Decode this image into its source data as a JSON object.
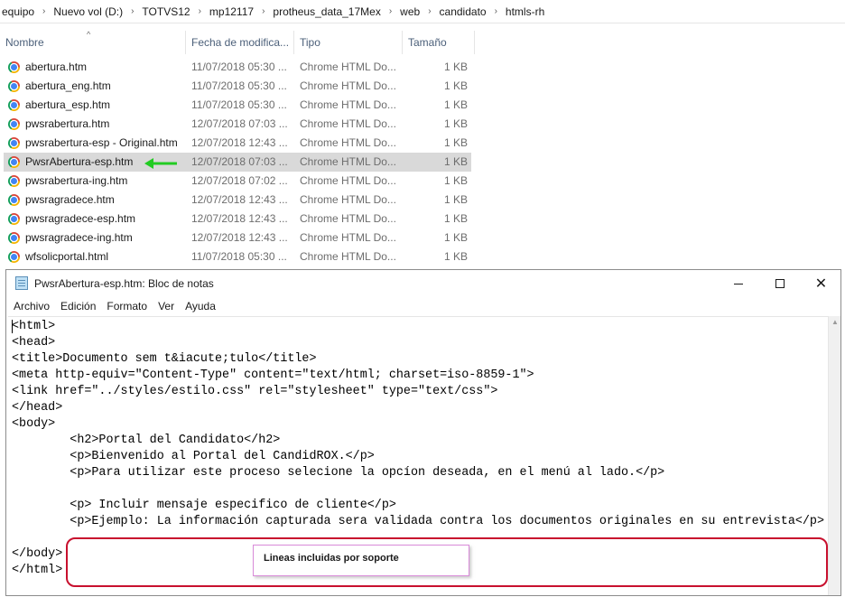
{
  "explorer": {
    "breadcrumb": [
      "equipo",
      "Nuevo vol (D:)",
      "TOTVS12",
      "mp12117",
      "protheus_data_17Mex",
      "web",
      "candidato",
      "htmls-rh"
    ],
    "breadcrumb_separator": "›",
    "columns": {
      "name": "Nombre",
      "date": "Fecha de modifica...",
      "type": "Tipo",
      "size": "Tamaño"
    },
    "sort_indicator": "^",
    "files": [
      {
        "name": "abertura.htm",
        "date": "11/07/2018 05:30 ...",
        "type": "Chrome HTML Do...",
        "size": "1 KB"
      },
      {
        "name": "abertura_eng.htm",
        "date": "11/07/2018 05:30 ...",
        "type": "Chrome HTML Do...",
        "size": "1 KB"
      },
      {
        "name": "abertura_esp.htm",
        "date": "11/07/2018 05:30 ...",
        "type": "Chrome HTML Do...",
        "size": "1 KB"
      },
      {
        "name": "pwsrabertura.htm",
        "date": "12/07/2018 07:03 ...",
        "type": "Chrome HTML Do...",
        "size": "1 KB"
      },
      {
        "name": "pwsrabertura-esp - Original.htm",
        "date": "12/07/2018 12:43 ...",
        "type": "Chrome HTML Do...",
        "size": "1 KB"
      },
      {
        "name": "PwsrAbertura-esp.htm",
        "date": "12/07/2018 07:03 ...",
        "type": "Chrome HTML Do...",
        "size": "1 KB",
        "selected": true
      },
      {
        "name": "pwsrabertura-ing.htm",
        "date": "12/07/2018 07:02 ...",
        "type": "Chrome HTML Do...",
        "size": "1 KB"
      },
      {
        "name": "pwsragradece.htm",
        "date": "12/07/2018 12:43 ...",
        "type": "Chrome HTML Do...",
        "size": "1 KB"
      },
      {
        "name": "pwsragradece-esp.htm",
        "date": "12/07/2018 12:43 ...",
        "type": "Chrome HTML Do...",
        "size": "1 KB"
      },
      {
        "name": "pwsragradece-ing.htm",
        "date": "12/07/2018 12:43 ...",
        "type": "Chrome HTML Do...",
        "size": "1 KB"
      },
      {
        "name": "wfsolicportal.html",
        "date": "11/07/2018 05:30 ...",
        "type": "Chrome HTML Do...",
        "size": "1 KB"
      }
    ],
    "file_icon": "chrome-html-icon",
    "selection_color": "#d9d9d9",
    "arrow_color": "#22cc22"
  },
  "notepad": {
    "title": "PwsrAbertura-esp.htm: Bloc de notas",
    "menu": [
      "Archivo",
      "Edición",
      "Formato",
      "Ver",
      "Ayuda"
    ],
    "window_buttons": {
      "minimize": "minimize-icon",
      "maximize": "maximize-icon",
      "close": "close-icon"
    },
    "close_glyph": "✕",
    "code_lines": [
      "<html>",
      "<head>",
      "<title>Documento sem t&iacute;tulo</title>",
      "<meta http-equiv=\"Content-Type\" content=\"text/html; charset=iso-8859-1\">",
      "<link href=\"../styles/estilo.css\" rel=\"stylesheet\" type=\"text/css\">",
      "</head>",
      "<body>",
      "        <h2>Portal del Candidato</h2>",
      "        <p>Bienvenido al Portal del CandidROX.</p>",
      "        <p>Para utilizar este proceso selecione la opcíon deseada, en el menú al lado.</p>",
      "",
      "        <p> Incluir mensaje especifico de cliente</p>",
      "        <p>Ejemplo: La información capturada sera validada contra los documentos originales en su entrevista</p>",
      "",
      "</body>",
      "</html>"
    ],
    "highlight_color": "#c8102e"
  },
  "callout": {
    "text": "Lineas incluidas por soporte",
    "border_color": "#d98bd9"
  }
}
